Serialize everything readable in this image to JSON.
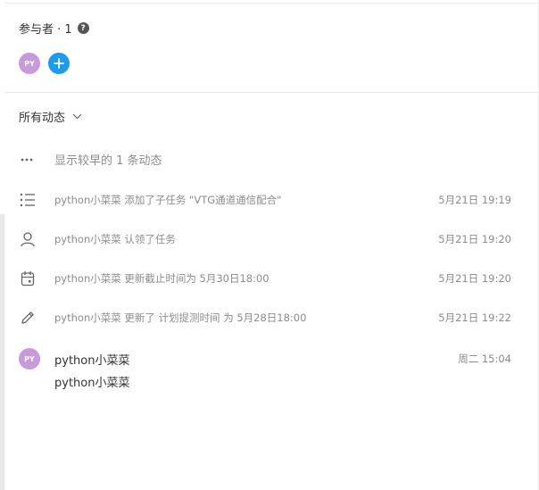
{
  "participants": {
    "title": "参与者 · 1",
    "help_icon": "?",
    "members": [
      {
        "initials": "PY",
        "color": "#c99adb"
      }
    ],
    "add_button": "add-participant"
  },
  "activity": {
    "filter_label": "所有动态",
    "show_earlier": "显示较早的 1 条动态",
    "items": [
      {
        "icon": "list-icon",
        "text": "python小菜菜 添加了子任务 \"VTG通道通信配合\"",
        "time": "5月21日 19:19"
      },
      {
        "icon": "user-icon",
        "text": "python小菜菜 认领了任务",
        "time": "5月21日 19:20"
      },
      {
        "icon": "calendar-icon",
        "text": "python小菜菜 更新截止时间为 5月30日18:00",
        "time": "5月21日 19:20"
      },
      {
        "icon": "pencil-icon",
        "text": "python小菜菜 更新了 计划提测时间 为 5月28日18:00",
        "time": "5月21日 19:22"
      }
    ],
    "comment": {
      "initials": "PY",
      "author": "python小菜菜",
      "time": "周二 15:04",
      "content": "python小菜菜"
    }
  }
}
